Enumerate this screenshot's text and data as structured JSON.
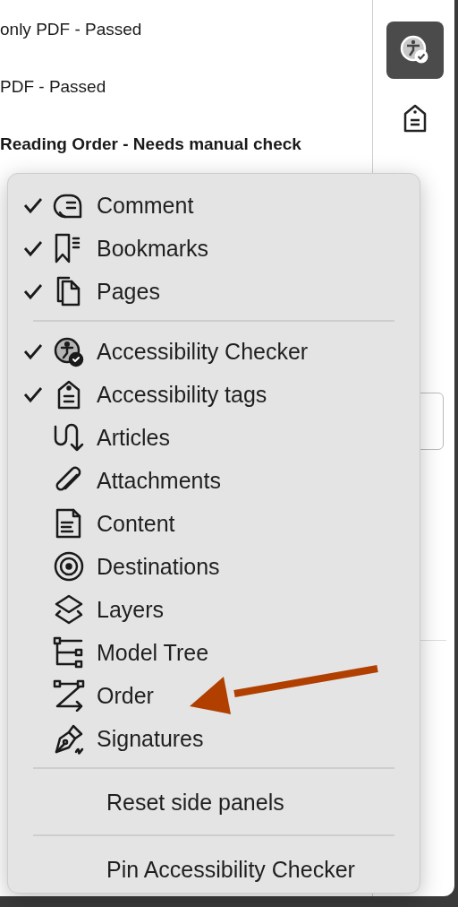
{
  "results": [
    {
      "text": "only PDF - Passed",
      "bold": false
    },
    {
      "text": "PDF - Passed",
      "bold": false
    },
    {
      "text": "Reading Order - Needs manual check",
      "bold": true
    }
  ],
  "toolbar": [
    {
      "selected": true
    },
    {
      "selected": false
    }
  ],
  "menu": {
    "groups": [
      [
        {
          "label": "Comment",
          "checked": true
        },
        {
          "label": "Bookmarks",
          "checked": true
        },
        {
          "label": "Pages",
          "checked": true
        }
      ],
      [
        {
          "label": "Accessibility Checker",
          "checked": true
        },
        {
          "label": "Accessibility tags",
          "checked": true
        },
        {
          "label": "Articles",
          "checked": false
        },
        {
          "label": "Attachments",
          "checked": false
        },
        {
          "label": "Content",
          "checked": false
        },
        {
          "label": "Destinations",
          "checked": false
        },
        {
          "label": "Layers",
          "checked": false
        },
        {
          "label": "Model Tree",
          "checked": false
        },
        {
          "label": "Order",
          "checked": false
        },
        {
          "label": "Signatures",
          "checked": false
        }
      ],
      [
        {
          "label": "Reset side panels",
          "checked": false
        }
      ],
      [
        {
          "label": "Pin Accessibility Checker",
          "checked": false
        }
      ]
    ]
  }
}
